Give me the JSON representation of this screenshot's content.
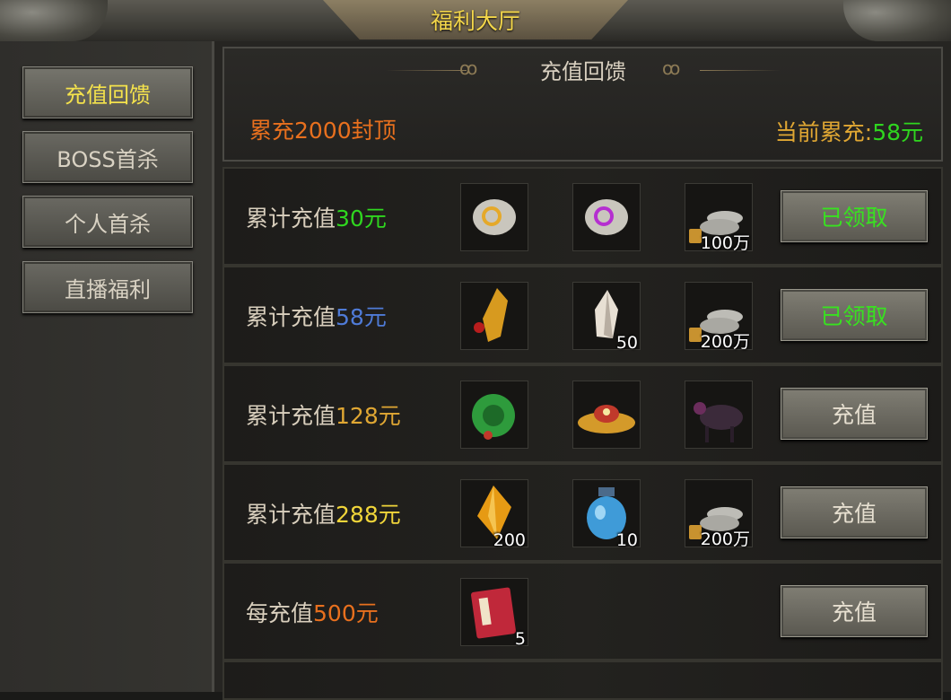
{
  "window": {
    "title": "福利大厅"
  },
  "sidebar": {
    "items": [
      {
        "label": "充值回馈",
        "active": true
      },
      {
        "label": "BOSS首杀",
        "active": false
      },
      {
        "label": "个人首杀",
        "active": false
      },
      {
        "label": "直播福利",
        "active": false
      }
    ]
  },
  "header": {
    "title": "充值回馈",
    "cap_text": "累充2000封顶",
    "current_label": "当前累充:",
    "current_value": "58元"
  },
  "rows": [
    {
      "label_prefix": "累计充值",
      "amount": "30元",
      "amount_color": "#2fd61f",
      "items": [
        {
          "icon": "gold-scroll-icon",
          "qty": ""
        },
        {
          "icon": "purple-scroll-icon",
          "qty": ""
        },
        {
          "icon": "bound-silver-icon",
          "qty": "100万"
        }
      ],
      "button": "已领取",
      "claimed": true
    },
    {
      "label_prefix": "累计充值",
      "amount": "58元",
      "amount_color": "#4f7bd7",
      "items": [
        {
          "icon": "golden-weapon-icon",
          "qty": ""
        },
        {
          "icon": "crystal-shard-icon",
          "qty": "50"
        },
        {
          "icon": "bound-silver-icon",
          "qty": "200万"
        }
      ],
      "button": "已领取",
      "claimed": true
    },
    {
      "label_prefix": "累计充值",
      "amount": "128元",
      "amount_color": "#e0a733",
      "items": [
        {
          "icon": "jade-pendant-icon",
          "qty": ""
        },
        {
          "icon": "jeweled-hat-icon",
          "qty": ""
        },
        {
          "icon": "dark-mount-icon",
          "qty": ""
        }
      ],
      "button": "充值",
      "claimed": false
    },
    {
      "label_prefix": "累计充值",
      "amount": "288元",
      "amount_color": "#f0d53a",
      "items": [
        {
          "icon": "amber-gem-icon",
          "qty": "200"
        },
        {
          "icon": "blue-potion-jar-icon",
          "qty": "10"
        },
        {
          "icon": "bound-silver-icon",
          "qty": "200万"
        }
      ],
      "button": "充值",
      "claimed": false
    },
    {
      "label_prefix": "每充值",
      "amount": "500元",
      "amount_color": "#e8701e",
      "items": [
        {
          "icon": "red-book-icon",
          "qty": "5"
        }
      ],
      "button": "充值",
      "claimed": false
    }
  ]
}
